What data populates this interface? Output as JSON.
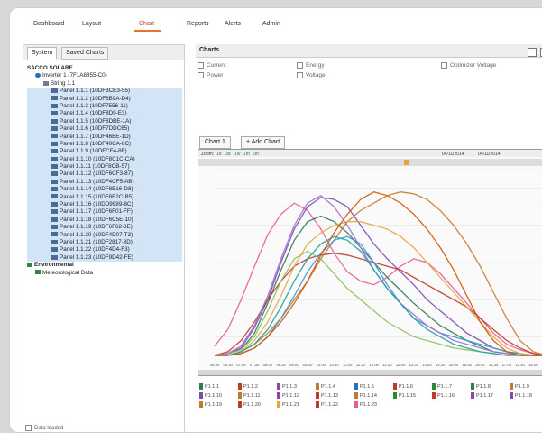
{
  "nav": [
    "Dashboard",
    "Layout",
    "Chart",
    "Reports",
    "Alerts",
    "Admin"
  ],
  "nav_active": "Chart",
  "sidebar": {
    "tabs": [
      "System",
      "Saved Charts"
    ],
    "tree": [
      {
        "label": "SACCO SOLARE",
        "indent": 0,
        "icon": "none",
        "sel": false
      },
      {
        "label": "Inverter 1 (7F1A8855-C0)",
        "indent": 1,
        "icon": "globe",
        "sel": false
      },
      {
        "label": "String 1.1",
        "indent": 2,
        "icon": "string",
        "sel": false
      },
      {
        "label": "Panel 1.1.1 (10DF3CE3-55)",
        "indent": 3,
        "icon": "panel",
        "sel": true
      },
      {
        "label": "Panel 1.1.2 (10DF6B9A-D4)",
        "indent": 3,
        "icon": "panel",
        "sel": true
      },
      {
        "label": "Panel 1.1.3 (10DF7556-11)",
        "indent": 3,
        "icon": "panel",
        "sel": true
      },
      {
        "label": "Panel 1.1.4 (10DF8D9-E3)",
        "indent": 3,
        "icon": "panel",
        "sel": true
      },
      {
        "label": "Panel 1.1.5 (10DF8DBE-1A)",
        "indent": 3,
        "icon": "panel",
        "sel": true
      },
      {
        "label": "Panel 1.1.6 (10DF7DDC65)",
        "indent": 3,
        "icon": "panel",
        "sel": true
      },
      {
        "label": "Panel 1.1.7 (10DF46BE-1D)",
        "indent": 3,
        "icon": "panel",
        "sel": true
      },
      {
        "label": "Panel 1.1.8 (10DF40CA-8C)",
        "indent": 3,
        "icon": "panel",
        "sel": true
      },
      {
        "label": "Panel 1.1.9 (10DFCF4-8F)",
        "indent": 3,
        "icon": "panel",
        "sel": true
      },
      {
        "label": "Panel 1.1.10 (10DF8C1C-CA)",
        "indent": 3,
        "icon": "panel",
        "sel": true
      },
      {
        "label": "Panel 1.1.11 (10DF8CB-57)",
        "indent": 3,
        "icon": "panel",
        "sel": true
      },
      {
        "label": "Panel 1.1.12 (10DF6CF3-87)",
        "indent": 3,
        "icon": "panel",
        "sel": true
      },
      {
        "label": "Panel 1.1.13 (10DF4CF5-AB)",
        "indent": 3,
        "icon": "panel",
        "sel": true
      },
      {
        "label": "Panel 1.1.14 (10DF8E16-D8)",
        "indent": 3,
        "icon": "panel",
        "sel": true
      },
      {
        "label": "Panel 1.1.15 (10DF8E2C-B5)",
        "indent": 3,
        "icon": "panel",
        "sel": true
      },
      {
        "label": "Panel 1.1.16 (10DD9989-8C)",
        "indent": 3,
        "icon": "panel",
        "sel": true
      },
      {
        "label": "Panel 1.1.17 (10DF6F01-FF)",
        "indent": 3,
        "icon": "panel",
        "sel": true
      },
      {
        "label": "Panel 1.1.18 (10DF6C5E-10)",
        "indent": 3,
        "icon": "panel",
        "sel": true
      },
      {
        "label": "Panel 1.1.19 (10DF6F62-8E)",
        "indent": 3,
        "icon": "panel",
        "sel": true
      },
      {
        "label": "Panel 1.1.20 (10DF4D07-T3)",
        "indent": 3,
        "icon": "panel",
        "sel": true
      },
      {
        "label": "Panel 1.1.21 (10DF2817-8D)",
        "indent": 3,
        "icon": "panel",
        "sel": true
      },
      {
        "label": "Panel 1.1.22 (10DF4D4-F3)",
        "indent": 3,
        "icon": "panel",
        "sel": true
      },
      {
        "label": "Panel 1.1.23 (10DF9D42-FE)",
        "indent": 3,
        "icon": "panel",
        "sel": true
      },
      {
        "label": "Environmental",
        "indent": 0,
        "icon": "env",
        "sel": false
      },
      {
        "label": "Meteorological Data",
        "indent": 1,
        "icon": "env",
        "sel": false
      }
    ],
    "status": "Data loaded"
  },
  "charts_panel": {
    "title": "Charts",
    "options": [
      "Current",
      "Energy",
      "Optimizer Voltage",
      "Power",
      "Voltage"
    ],
    "chart_tabs": [
      "Chart 1",
      "+ Add Chart"
    ],
    "zoom_label": "Zoom:",
    "zoom_opts": [
      "1d",
      "3d",
      "1w",
      "1m",
      "6m"
    ],
    "date_from": "04/11/2014",
    "date_to": "04/11/2014"
  },
  "chart_data": {
    "type": "line",
    "x": [
      "06:00",
      "06:30",
      "07:00",
      "07:30",
      "08:00",
      "08:30",
      "09:00",
      "09:30",
      "10:00",
      "10:30",
      "11:00",
      "11:30",
      "12:00",
      "12:30",
      "13:00",
      "13:30",
      "14:00",
      "14:30",
      "15:00",
      "15:30",
      "16:00",
      "16:30",
      "17:00",
      "17:30",
      "18:00",
      "18:30"
    ],
    "ylim": [
      0,
      100
    ],
    "grid": true,
    "series": [
      {
        "color": "#e85a9a",
        "values": [
          5,
          14,
          30,
          48,
          65,
          76,
          82,
          78,
          68,
          55,
          45,
          40,
          38,
          42,
          48,
          52,
          50,
          44,
          36,
          28,
          20,
          12,
          6,
          3,
          1,
          0
        ]
      },
      {
        "color": "#7b4bb0",
        "values": [
          0,
          1,
          4,
          15,
          30,
          50,
          68,
          80,
          85,
          84,
          80,
          70,
          60,
          52,
          45,
          38,
          30,
          24,
          18,
          12,
          8,
          4,
          2,
          1,
          0,
          0
        ]
      },
      {
        "color": "#2e7d4f",
        "values": [
          0,
          1,
          3,
          12,
          28,
          46,
          62,
          72,
          75,
          72,
          66,
          58,
          50,
          42,
          35,
          28,
          22,
          16,
          12,
          8,
          5,
          2,
          1,
          0,
          0,
          0
        ]
      },
      {
        "color": "#c0392b",
        "values": [
          0,
          2,
          8,
          18,
          30,
          40,
          48,
          52,
          54,
          55,
          54,
          52,
          50,
          48,
          46,
          42,
          38,
          34,
          30,
          26,
          20,
          14,
          8,
          4,
          1,
          0
        ]
      },
      {
        "color": "#c47a2c",
        "values": [
          0,
          0,
          2,
          6,
          12,
          20,
          30,
          40,
          52,
          62,
          72,
          78,
          82,
          86,
          88,
          87,
          84,
          78,
          70,
          60,
          48,
          34,
          20,
          8,
          2,
          0
        ]
      },
      {
        "color": "#3498db",
        "values": [
          0,
          0,
          1,
          4,
          10,
          20,
          32,
          45,
          55,
          62,
          64,
          60,
          50,
          38,
          28,
          20,
          16,
          12,
          10,
          8,
          6,
          4,
          2,
          1,
          0,
          0
        ]
      },
      {
        "color": "#8fbf5a",
        "values": [
          0,
          1,
          3,
          10,
          24,
          40,
          52,
          56,
          52,
          44,
          36,
          30,
          24,
          18,
          14,
          10,
          8,
          6,
          4,
          3,
          2,
          1,
          0,
          0,
          0,
          0
        ]
      },
      {
        "color": "#e6a83c",
        "values": [
          0,
          0,
          2,
          8,
          18,
          32,
          48,
          60,
          66,
          70,
          72,
          72,
          70,
          68,
          64,
          58,
          50,
          42,
          34,
          26,
          18,
          10,
          4,
          1,
          0,
          0
        ]
      },
      {
        "color": "#a56bd1",
        "values": [
          0,
          1,
          5,
          16,
          32,
          52,
          70,
          82,
          86,
          80,
          70,
          58,
          46,
          36,
          28,
          22,
          16,
          12,
          8,
          6,
          4,
          2,
          1,
          0,
          0,
          0
        ]
      },
      {
        "color": "#1aa39a",
        "values": [
          0,
          0,
          2,
          6,
          14,
          26,
          40,
          52,
          60,
          64,
          62,
          56,
          46,
          36,
          28,
          20,
          14,
          10,
          6,
          4,
          2,
          1,
          0,
          0,
          0,
          0
        ]
      },
      {
        "color": "#d35400",
        "values": [
          0,
          0,
          1,
          4,
          10,
          18,
          28,
          40,
          54,
          66,
          76,
          84,
          88,
          86,
          82,
          76,
          68,
          58,
          46,
          32,
          18,
          8,
          2,
          0,
          0,
          0
        ]
      }
    ]
  },
  "legend": [
    "P1.1.1",
    "P1.1.2",
    "P1.1.3",
    "P1.1.4",
    "P1.1.5",
    "P1.1.6",
    "P1.1.7",
    "P1.1.8",
    "P1.1.9",
    "P1.1.10",
    "P1.1.11",
    "P1.1.12",
    "P1.1.13",
    "P1.1.14",
    "P1.1.15",
    "P1.1.16",
    "P1.1.17",
    "P1.1.18",
    "P1.1.19",
    "P1.1.20",
    "P1.1.21",
    "P1.1.22",
    "P1.1.23"
  ],
  "legend_colors": [
    "#2e7d4f",
    "#c0392b",
    "#8e44ad",
    "#c47a2c",
    "#2c6fbe",
    "#c0392b",
    "#2a8a3b",
    "#2e7d4f",
    "#c47a2c",
    "#7b4bb0",
    "#c47a2c",
    "#8e44ad",
    "#c0392b",
    "#c47a2c",
    "#2a8a3b",
    "#c0392b",
    "#8e44ad",
    "#7b4bb0",
    "#c47a2c",
    "#c0392b",
    "#e6a83c",
    "#c0392b",
    "#e85a9a"
  ]
}
